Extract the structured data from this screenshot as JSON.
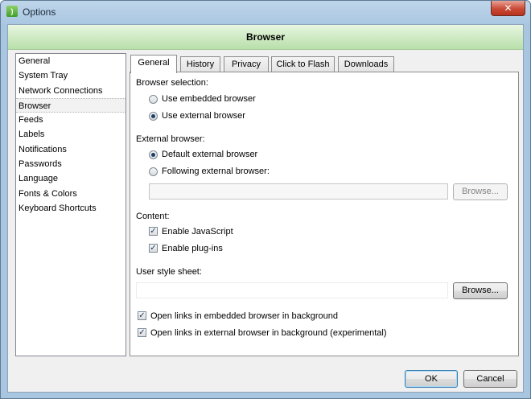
{
  "window": {
    "title": "Options",
    "close_glyph": "✕",
    "app_icon": "rss-feed-icon"
  },
  "header": {
    "title": "Browser"
  },
  "sidebar": {
    "items": [
      {
        "label": "General"
      },
      {
        "label": "System Tray"
      },
      {
        "label": "Network Connections"
      },
      {
        "label": "Browser",
        "selected": true
      },
      {
        "label": "Feeds"
      },
      {
        "label": "Labels"
      },
      {
        "label": "Notifications"
      },
      {
        "label": "Passwords"
      },
      {
        "label": "Language"
      },
      {
        "label": "Fonts & Colors"
      },
      {
        "label": "Keyboard Shortcuts"
      }
    ]
  },
  "tabs": [
    {
      "label": "General",
      "active": true
    },
    {
      "label": "History"
    },
    {
      "label": "Privacy"
    },
    {
      "label": "Click to Flash"
    },
    {
      "label": "Downloads"
    }
  ],
  "general": {
    "browser_selection": {
      "label": "Browser selection:",
      "embedded": "Use embedded browser",
      "external": "Use external browser",
      "selected": "external"
    },
    "external_browser": {
      "label": "External browser:",
      "default": "Default external browser",
      "following": "Following external browser:",
      "selected": "default",
      "path_value": "",
      "browse_label": "Browse..."
    },
    "content": {
      "label": "Content:",
      "javascript": "Enable JavaScript",
      "javascript_checked": true,
      "plugins": "Enable plug-ins",
      "plugins_checked": true
    },
    "style_sheet": {
      "label": "User style sheet:",
      "path_value": "",
      "browse_label": "Browse..."
    },
    "open_embedded_bg": "Open links in embedded browser in background",
    "open_embedded_bg_checked": true,
    "open_external_bg": "Open links in external browser in background (experimental)",
    "open_external_bg_checked": true
  },
  "buttons": {
    "ok": "OK",
    "cancel": "Cancel"
  },
  "check_glyph": "✓"
}
